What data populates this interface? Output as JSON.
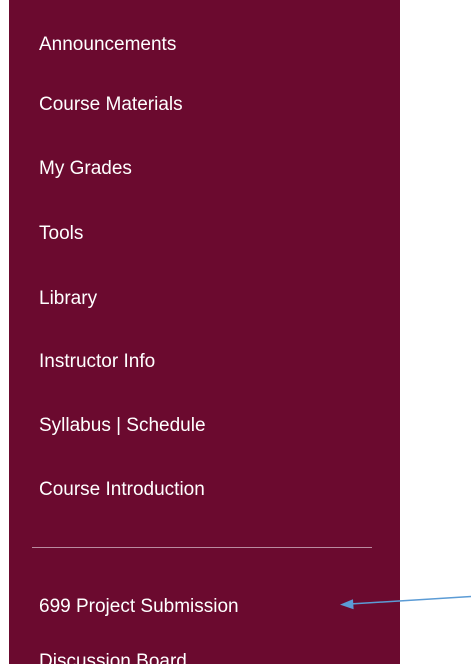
{
  "sidebar": {
    "background_color": "#6b0a2f",
    "items": [
      {
        "label": "Announcements"
      },
      {
        "label": "Course Materials"
      },
      {
        "label": "My Grades"
      },
      {
        "label": "Tools"
      },
      {
        "label": "Library"
      },
      {
        "label": "Instructor Info"
      },
      {
        "label": "Syllabus | Schedule"
      },
      {
        "label": "Course Introduction"
      }
    ],
    "secondary_items": [
      {
        "label": "699 Project Submission"
      },
      {
        "label": "Discussion Board"
      }
    ]
  },
  "annotation": {
    "arrow_color": "#5b9bd5"
  }
}
